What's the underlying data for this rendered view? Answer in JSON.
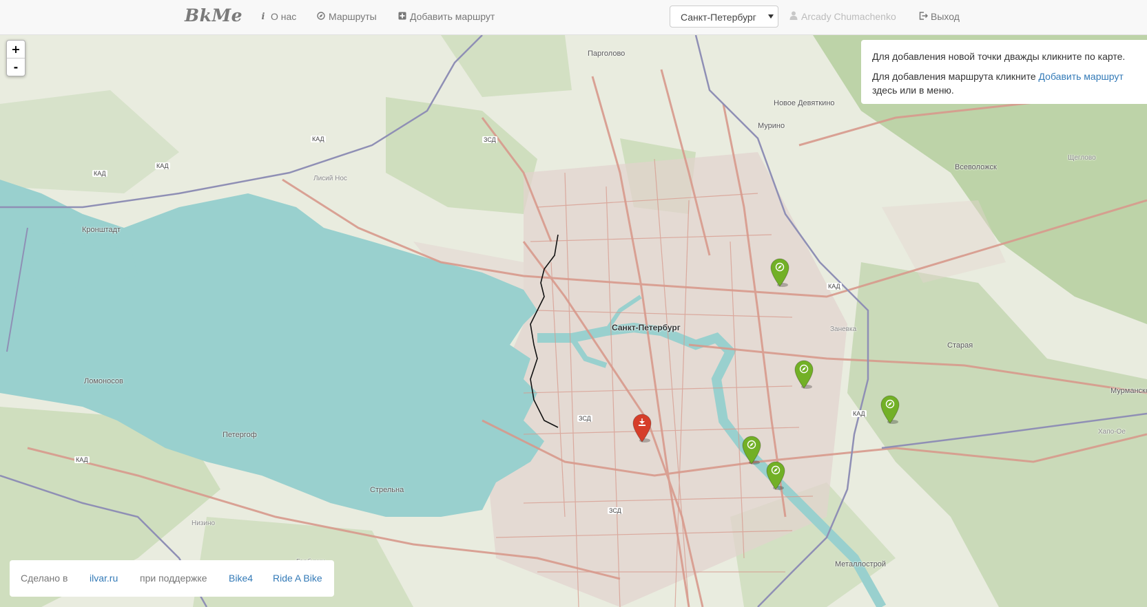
{
  "navbar": {
    "brand": "BkMe",
    "about": {
      "icon": "info-icon",
      "label": "О нас"
    },
    "routes": {
      "icon": "compass-icon",
      "label": "Маршруты"
    },
    "add_route": {
      "icon": "plus-square-icon",
      "label": "Добавить маршрут"
    },
    "city": {
      "selected": "Санкт-Петербург"
    },
    "user": {
      "icon": "user-icon",
      "label": "Arcady Chumachenko"
    },
    "logout": {
      "icon": "logout-icon",
      "label": "Выход"
    }
  },
  "zoom": {
    "in": "+",
    "out": "-"
  },
  "info": {
    "line1": "Для добавления новой точки дважды кликните по карте.",
    "line2_before": "Для добавления маршрута кликните",
    "line2_link": "Добавить маршрут",
    "line2_after": "здесь или в меню."
  },
  "footer": {
    "made_in": "Сделано в",
    "ilvar": "ilvar.ru",
    "support": "при поддержке",
    "bike4": "Bike4",
    "rideabike": "Ride A Bike"
  },
  "map": {
    "labels": {
      "pargolovo": "Парголово",
      "novoe_devyatkino": "Новое Девяткино",
      "murino": "Мурино",
      "vsevolozhsk": "Всеволожск",
      "scheglovo": "Щеглово",
      "lisiy_nos": "Лисий Нос",
      "kronshtadt": "Кронштадт",
      "spb": "Санкт-Петербург",
      "zanevka": "Заневка",
      "staraya": "Старая",
      "lomonosov": "Ломоносов",
      "petergof": "Петергоф",
      "strelna": "Стрельна",
      "nizino": "Низино",
      "murmanskoe": "Мурманское",
      "hapo_oe": "Хапо-Ое",
      "metallostroy": "Металлострой",
      "gorbunki": "Горбунки",
      "kad": "КАД",
      "zsd": "ЗСД"
    },
    "markers": [
      {
        "type": "start",
        "color": "#d63e2a",
        "icon": "start-flag-icon"
      },
      {
        "type": "point",
        "color": "#72b026",
        "icon": "compass-icon"
      },
      {
        "type": "point",
        "color": "#72b026",
        "icon": "compass-icon"
      },
      {
        "type": "point",
        "color": "#72b026",
        "icon": "compass-icon"
      },
      {
        "type": "point",
        "color": "#72b026",
        "icon": "compass-icon"
      },
      {
        "type": "point",
        "color": "#72b026",
        "icon": "compass-icon"
      }
    ],
    "colors": {
      "water": "#99d0ce",
      "land": "#e9ecdf",
      "forest": "#b5cf9f",
      "road": "#d7998c",
      "kad": "#8f8fb5"
    }
  }
}
